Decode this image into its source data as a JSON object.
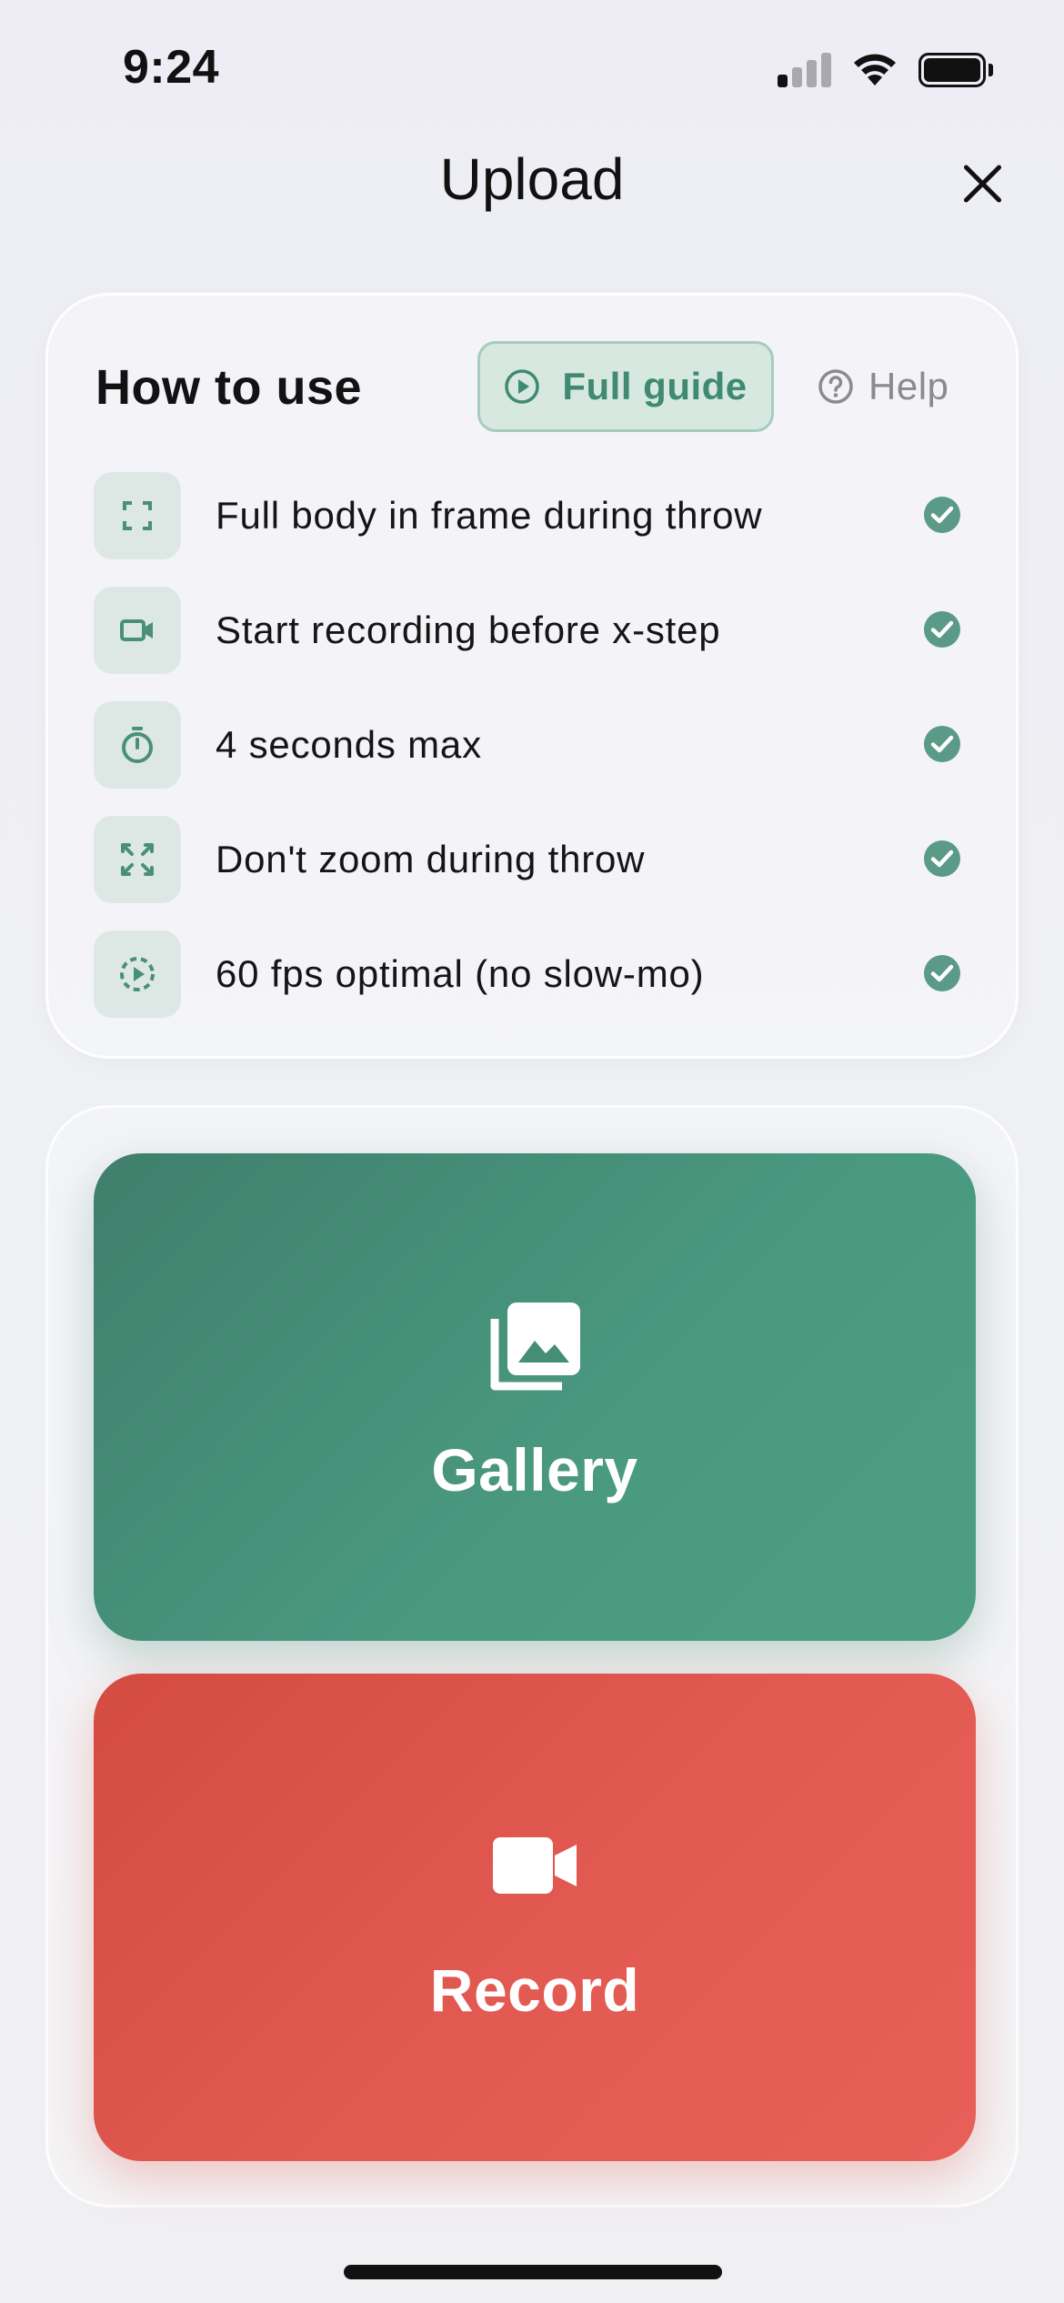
{
  "status_bar": {
    "time": "9:24"
  },
  "header": {
    "title": "Upload"
  },
  "guide": {
    "title": "How to use",
    "full_guide_label": "Full guide",
    "help_label": "Help",
    "tips": [
      {
        "icon": "frame-corners-icon",
        "text": "Full body in frame during throw",
        "checked": true
      },
      {
        "icon": "video-camera-icon",
        "text": "Start recording before x-step",
        "checked": true
      },
      {
        "icon": "stopwatch-icon",
        "text": "4 seconds max",
        "checked": true
      },
      {
        "icon": "no-zoom-icon",
        "text": "Don't zoom during throw",
        "checked": true
      },
      {
        "icon": "fps-play-icon",
        "text": "60 fps optimal (no slow-mo)",
        "checked": true
      }
    ]
  },
  "actions": {
    "gallery_label": "Gallery",
    "record_label": "Record"
  },
  "colors": {
    "accent_green": "#4a9a80",
    "accent_red": "#e25a52",
    "check_green": "#5a9a86"
  }
}
